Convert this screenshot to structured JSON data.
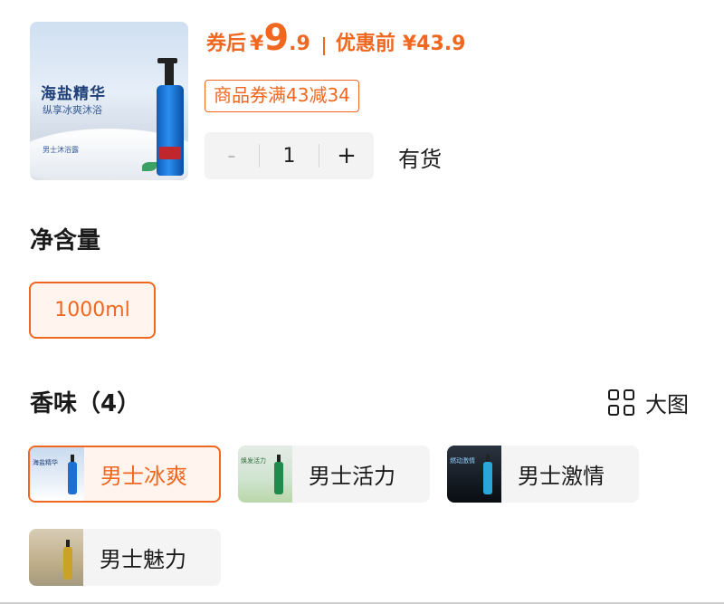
{
  "product": {
    "image_title": "海盐精华",
    "image_subtitle": "纵享冰爽沐浴",
    "image_tag": "男士沐浴露"
  },
  "price": {
    "after_coupon_label": "券后",
    "currency": "¥",
    "after_coupon_int": "9",
    "after_coupon_dec": ".9",
    "before_label": "优惠前",
    "before_price": "¥43.9"
  },
  "coupon": {
    "text": "商品券满43减34"
  },
  "quantity": {
    "minus": "-",
    "value": "1",
    "plus": "+",
    "stock_status": "有货"
  },
  "volume": {
    "title": "净含量",
    "options": [
      {
        "label": "1000ml",
        "selected": true
      }
    ]
  },
  "scent": {
    "title": "香味（4）",
    "big_image_label": "大图",
    "options": [
      {
        "label": "男士冰爽",
        "selected": true,
        "image_text": "海盐精华"
      },
      {
        "label": "男士活力",
        "selected": false,
        "image_text": "焕发活力"
      },
      {
        "label": "男士激情",
        "selected": false,
        "image_text": "燃动激情"
      },
      {
        "label": "男士魅力",
        "selected": false,
        "image_text": ""
      }
    ]
  },
  "colors": {
    "accent": "#f0671f",
    "accent_bg": "#fff4ee",
    "chip_bg": "#f4f4f4"
  }
}
